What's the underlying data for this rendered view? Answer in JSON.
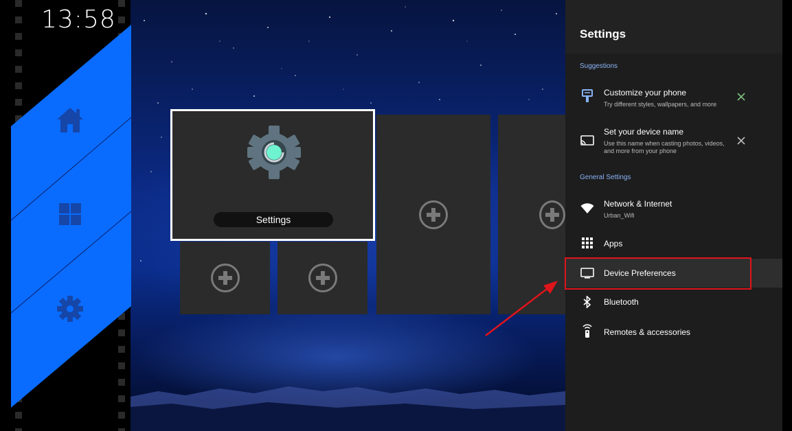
{
  "clock": "13:58",
  "launcher": {
    "focused_tile": {
      "label": "Settings"
    },
    "nav": [
      "home-icon",
      "grid-icon",
      "gear-icon"
    ]
  },
  "settings": {
    "title": "Settings",
    "suggestions_header": "Suggestions",
    "suggestions": [
      {
        "title": "Customize your phone",
        "subtitle": "Try different styles, wallpapers, and more"
      },
      {
        "title": "Set your device name",
        "subtitle": "Use this name when casting photos, videos, and more from your phone"
      }
    ],
    "general_header": "General Settings",
    "items": [
      {
        "title": "Network & Internet",
        "subtitle": "Urban_Wifi"
      },
      {
        "title": "Apps"
      },
      {
        "title": "Device Preferences"
      },
      {
        "title": "Bluetooth"
      },
      {
        "title": "Remotes & accessories"
      }
    ]
  },
  "colors": {
    "accent_blue": "#0a6cff",
    "highlight_red": "#e0141b",
    "check_green": "#7fbf7f",
    "section_blue": "#8ab4f8"
  }
}
